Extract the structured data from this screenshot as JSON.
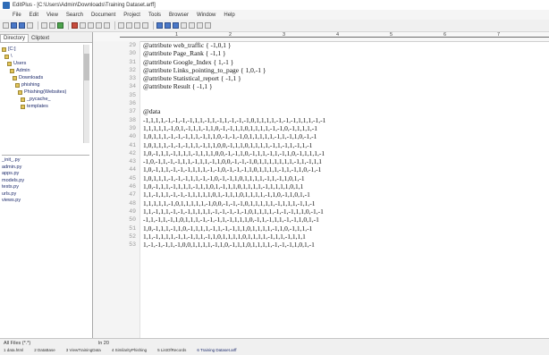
{
  "window": {
    "title": "EditPlus - [C:\\Users\\Admin\\Downloads\\Training Dataset.arff]"
  },
  "menu": [
    "File",
    "Edit",
    "View",
    "Search",
    "Document",
    "Project",
    "Tools",
    "Browser",
    "Window",
    "Help"
  ],
  "sidebar": {
    "tabs": [
      "Directory",
      "Cliptext"
    ],
    "tree": [
      "[C:]",
      "\\",
      "Users",
      "Admin",
      "Downloads",
      "phishing",
      "Phishing(Websites)",
      "_pycache_",
      "templates"
    ],
    "files": [
      "_init_.py",
      "admin.py",
      "apps.py",
      "models.py",
      "tests.py",
      "urls.py",
      "views.py"
    ],
    "filter": "All Files (*.*)"
  },
  "ruler": {
    "numbers": [
      "1",
      "2",
      "3",
      "4",
      "5",
      "6",
      "7"
    ]
  },
  "editor": {
    "lines": [
      {
        "n": "29",
        "text": "@attribute web_traffic  { -1,0,1 }"
      },
      {
        "n": "30",
        "text": "@attribute Page_Rank  { -1,1 }"
      },
      {
        "n": "31",
        "text": "@attribute Google_Index  { 1,-1 }"
      },
      {
        "n": "32",
        "text": "@attribute Links_pointing_to_page  { 1,0,-1 }"
      },
      {
        "n": "33",
        "text": "@attribute Statistical_report  { -1,1 }"
      },
      {
        "n": "34",
        "text": "@attribute Result  { -1,1 }"
      },
      {
        "n": "35",
        "text": ""
      },
      {
        "n": "36",
        "text": ""
      },
      {
        "n": "37",
        "text": "@data"
      },
      {
        "n": "38",
        "text": "-1,1,1,1,-1,-1,-1,-1,1,1,-1,1,-1,1,-1,-1,-1,0,1,1,1,1,-1,-1,-1,1,1,1,-1,-1"
      },
      {
        "n": "39",
        "text": "1,1,1,1,1,-1,0,1,-1,1,1,-1,1,0,-1,-1,1,1,0,1,1,1,1,-1,-1,0,-1,1,1,1,-1"
      },
      {
        "n": "40",
        "text": "1,0,1,1,1,-1,-1,-1,1,1,-1,1,1,0,-1,-1,-1,0,1,1,1,1,1,-1,1,-1,1,0,-1,-1"
      },
      {
        "n": "41",
        "text": "1,0,1,1,1,-1,-1,-1,1,1,-1,1,1,0,0,-1,1,1,0,1,1,1,1,-1,1,-1,1,-1,1,-1"
      },
      {
        "n": "42",
        "text": "1,0,-1,1,1,-1,1,1,1,-1,1,1,1,0,0,-1,-1,1,0,-1,1,1,-1,1,-1,1,0,-1,1,1,1,-1"
      },
      {
        "n": "43",
        "text": "-1,0,-1,1,-1,-1,1,1,-1,1,1,-1,1,0,0,-1,-1,-1,0,1,1,1,1,1,1,1,-1,1,-1,1,1"
      },
      {
        "n": "44",
        "text": "1,0,-1,1,1,-1,-1,-1,1,1,1,-1,-1,0,-1,-1,-1,1,0,1,1,1,1,-1,1,-1,1,0,-1,-1"
      },
      {
        "n": "45",
        "text": "1,0,1,1,1,-1,-1,-1,1,1,-1,-1,0,-1,-1,1,0,1,1,1,1,-1,1,-1,1,0,1,-1"
      },
      {
        "n": "46",
        "text": "1,0,-1,1,1,-1,1,1,1,-1,1,1,0,1,-1,1,1,0,1,1,1,1,-1,1,1,1,1,0,1,1"
      },
      {
        "n": "47",
        "text": "1,1,-1,1,1,-1,-1,-1,1,1,1,1,0,1,-1,1,1,0,1,1,1,1,-1,1,0,-1,1,0,1,-1"
      },
      {
        "n": "48",
        "text": "1,1,1,1,1,-1,0,1,1,1,1,1,-1,0,0,-1,-1,-1,0,1,1,1,1,1,-1,1,1,1,-1,1,-1"
      },
      {
        "n": "49",
        "text": "1,1,-1,1,1,-1,-1,-1,1,1,1,1,-1,-1,-1,-1,-1,0,1,1,1,1,-1,-1,-1,1,1,0,-1,-1"
      },
      {
        "n": "50",
        "text": "-1,1,-1,1,-1,1,0,1,1,1,-1,-1,-1,1,-1,1,1,1,0,-1,1,-1,1,1,-1,-1,1,0,1,-1"
      },
      {
        "n": "51",
        "text": "1,0,-1,1,1,-1,1,0,-1,1,1,1,-1,1,-1,-1,1,1,0,1,1,1,1,-1,1,0,-1,1,1,-1"
      },
      {
        "n": "52",
        "text": "1,1,-1,1,1,1,-1,1,-1,1,1,-1,1,0,1,1,1,1,0,1,1,1,1,-1,1,1,-1,1,1,1"
      },
      {
        "n": "53",
        "text": "1,-1,-1,-1,1,-1,0,0,1,1,1,1,-1,1,0,-1,1,1,0,1,1,1,1,-1,-1,-1,1,0,1,-1"
      }
    ]
  },
  "status": {
    "line": "ln 20"
  },
  "taskbar": [
    "1 data.html",
    "2 DataBase",
    "3 ViewTrainingData",
    "4 SimilarityPhishing",
    "5 ListOfRecords",
    "6 Training Dataset.arff"
  ]
}
